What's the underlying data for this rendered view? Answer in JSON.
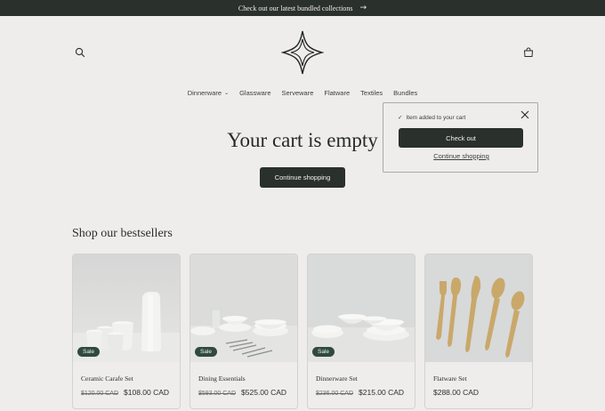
{
  "announcement": {
    "text": "Check out our latest bundled collections",
    "arrow": "→"
  },
  "header": {
    "search_icon": "search-icon",
    "cart_icon": "cart-icon",
    "logo": "four-point-star-logo"
  },
  "nav": {
    "items": [
      {
        "label": "Dinnerware",
        "has_dropdown": true
      },
      {
        "label": "Glassware"
      },
      {
        "label": "Serveware"
      },
      {
        "label": "Flatware"
      },
      {
        "label": "Textiles"
      },
      {
        "label": "Bundles"
      }
    ],
    "dropdown_glyph": "⌄"
  },
  "cart": {
    "empty_title": "Your cart is empty",
    "continue_label": "Continue shopping"
  },
  "popup": {
    "added_text": "Item added to your cart",
    "checkout_label": "Check out",
    "continue_link": "Continue shopping",
    "check_glyph": "✓"
  },
  "bestsellers": {
    "title": "Shop our bestsellers",
    "products": [
      {
        "name": "Ceramic Carafe Set",
        "old_price": "$120.00 CAD",
        "price": "$108.00 CAD",
        "badge": "Sale"
      },
      {
        "name": "Dining Essentials",
        "old_price": "$593.00 CAD",
        "price": "$525.00 CAD",
        "badge": "Sale"
      },
      {
        "name": "Dinnerware Set",
        "old_price": "$236.00 CAD",
        "price": "$215.00 CAD",
        "badge": "Sale"
      },
      {
        "name": "Flatware Set",
        "old_price": "",
        "price": "$288.00 CAD",
        "badge": ""
      }
    ]
  },
  "colors": {
    "background": "#efedeb",
    "primary": "#2a302c",
    "sale_badge": "#2f4a3f",
    "flatware_gold": "#c9a86a"
  }
}
